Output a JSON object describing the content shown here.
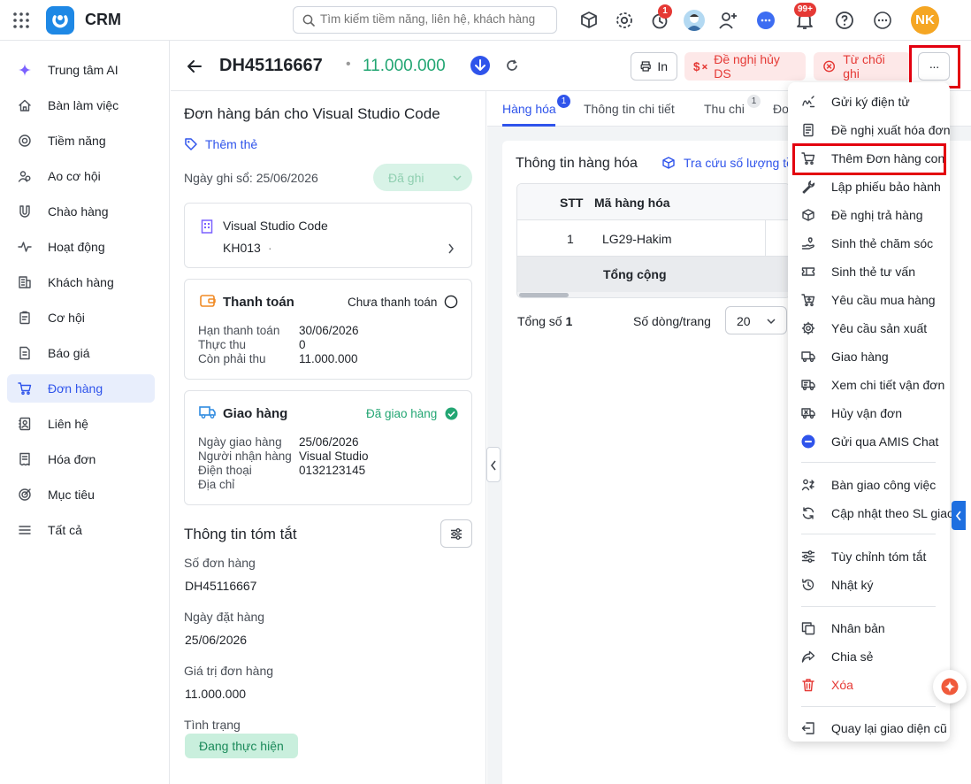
{
  "app": {
    "brand": "CRM"
  },
  "search": {
    "placeholder": "Tìm kiếm tiềm năng, liên hệ, khách hàng"
  },
  "topbar_badges": {
    "timer": "1",
    "notifications": "99+"
  },
  "user": {
    "initials": "NK"
  },
  "sidebar": {
    "items": [
      {
        "label": "Trung tâm AI",
        "icon": "sparkle-icon"
      },
      {
        "label": "Bàn làm việc",
        "icon": "home-icon"
      },
      {
        "label": "Tiềm năng",
        "icon": "target-icon"
      },
      {
        "label": "Ao cơ hội",
        "icon": "people-icon"
      },
      {
        "label": "Chào hàng",
        "icon": "magnet-icon"
      },
      {
        "label": "Hoạt động",
        "icon": "activity-icon"
      },
      {
        "label": "Khách hàng",
        "icon": "building-icon"
      },
      {
        "label": "Cơ hội",
        "icon": "clipboard-icon"
      },
      {
        "label": "Báo giá",
        "icon": "document-icon"
      },
      {
        "label": "Đơn hàng",
        "icon": "cart-icon"
      },
      {
        "label": "Liên hệ",
        "icon": "contact-icon"
      },
      {
        "label": "Hóa đơn",
        "icon": "invoice-icon"
      },
      {
        "label": "Mục tiêu",
        "icon": "goal-icon"
      },
      {
        "label": "Tất cả",
        "icon": "menu-icon"
      }
    ]
  },
  "header": {
    "order_number": "DH45116667",
    "separator": "•",
    "amount": "11.000.000",
    "print_label": "In",
    "cancel_request_label": "Đề nghị hủy DS",
    "reject_label": "Từ chối ghi",
    "more_label": "···"
  },
  "left": {
    "title": "Đơn hàng bán cho Visual Studio Code",
    "add_tag": "Thêm thẻ",
    "record_date": "Ngày ghi sổ: 25/06/2026",
    "status_button": "Đã ghi",
    "customer": {
      "name": "Visual Studio Code",
      "code": "KH013",
      "code_suffix": "·"
    },
    "payment": {
      "title": "Thanh toán",
      "status": "Chưa thanh toán",
      "rows": [
        {
          "label": "Hạn thanh toán",
          "value": "30/06/2026"
        },
        {
          "label": "Thực thu",
          "value": "0"
        },
        {
          "label": "Còn phải thu",
          "value": "11.000.000"
        }
      ]
    },
    "delivery": {
      "title": "Giao hàng",
      "status": "Đã giao hàng",
      "rows": [
        {
          "label": "Ngày giao hàng",
          "value": "25/06/2026"
        },
        {
          "label": "Người nhận hàng",
          "value": "Visual Studio"
        },
        {
          "label": "Điện thoại",
          "value": "0132123145"
        },
        {
          "label": "Địa chỉ",
          "value": ""
        }
      ]
    },
    "summary": {
      "title": "Thông tin tóm tắt",
      "fields": [
        {
          "label": "Số đơn hàng",
          "value": "DH45116667"
        },
        {
          "label": "Ngày đặt hàng",
          "value": "25/06/2026"
        },
        {
          "label": "Giá trị đơn hàng",
          "value": "11.000.000"
        },
        {
          "label": "Tình trạng",
          "value": "Đang thực hiện"
        }
      ]
    }
  },
  "tabs": [
    {
      "label": "Hàng hóa",
      "badge": "1"
    },
    {
      "label": "Thông tin chi tiết",
      "badge": ""
    },
    {
      "label": "Thu chi",
      "badge": "1"
    },
    {
      "label": "Đơ",
      "badge": ""
    }
  ],
  "goods": {
    "title": "Thông tin hàng hóa",
    "lookup_link": "Tra cứu số lượng tồ",
    "columns": [
      "STT",
      "Mã hàng hóa"
    ],
    "rows": [
      {
        "stt": "1",
        "code": "LG29-Hakim"
      }
    ],
    "total_label": "Tổng cộng",
    "count_label": "Tổng số",
    "count_value": "1",
    "rows_per_page_label": "Số dòng/trang",
    "rows_per_page_value": "20"
  },
  "menu": {
    "groups": [
      [
        {
          "label": "Gửi ký điện tử",
          "icon": "signature-icon"
        },
        {
          "label": "Đề nghị xuất hóa đơn",
          "icon": "receipt-icon"
        },
        {
          "label": "Thêm Đơn hàng con",
          "icon": "cart-icon"
        },
        {
          "label": "Lập phiếu bảo hành",
          "icon": "wrench-icon"
        },
        {
          "label": "Đề nghị trả hàng",
          "icon": "return-box-icon"
        },
        {
          "label": "Sinh thẻ chăm sóc",
          "icon": "care-hand-icon"
        },
        {
          "label": "Sinh thẻ tư vấn",
          "icon": "ticket-icon"
        },
        {
          "label": "Yêu cầu mua hàng",
          "icon": "cart-plus-icon"
        },
        {
          "label": "Yêu cầu sản xuất",
          "icon": "gear-icon"
        },
        {
          "label": "Giao hàng",
          "icon": "truck-icon"
        },
        {
          "label": "Xem chi tiết vận đơn",
          "icon": "truck-search-icon"
        },
        {
          "label": "Hủy vận đơn",
          "icon": "truck-cancel-icon"
        },
        {
          "label": "Gửi qua AMIS Chat",
          "icon": "chat-icon"
        }
      ],
      [
        {
          "label": "Bàn giao công việc",
          "icon": "handover-icon"
        },
        {
          "label": "Cập nhật theo SL giao",
          "icon": "sync-icon"
        }
      ],
      [
        {
          "label": "Tùy chỉnh tóm tắt",
          "icon": "sliders-icon"
        },
        {
          "label": "Nhật ký",
          "icon": "history-icon"
        }
      ],
      [
        {
          "label": "Nhân bản",
          "icon": "copy-icon"
        },
        {
          "label": "Chia sẻ",
          "icon": "share-icon"
        },
        {
          "label": "Xóa",
          "icon": "trash-icon",
          "danger": true
        }
      ],
      [
        {
          "label": "Quay lại giao diện cũ",
          "icon": "exit-icon"
        }
      ]
    ]
  },
  "colors": {
    "accent": "#2f54eb",
    "success": "#23a673",
    "danger": "#e53935",
    "highlight": "#e3000f"
  }
}
